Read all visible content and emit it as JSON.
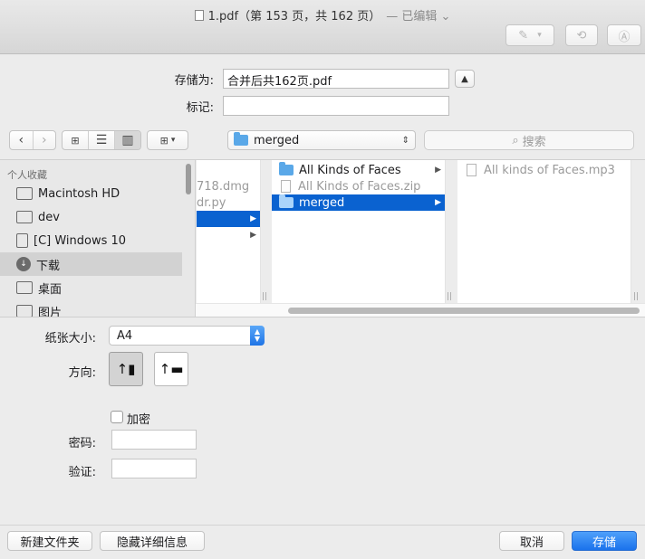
{
  "titlebar": {
    "title": "1.pdf（第 153 页，共 162 页）",
    "edited": "— 已编辑 ⌄"
  },
  "save": {
    "save_as_label": "存储为:",
    "filename": "合并后共162页.pdf",
    "tags_label": "标记:",
    "tags_value": ""
  },
  "toolbar": {
    "location": "merged",
    "search_placeholder": "搜索"
  },
  "sidebar": {
    "heading": "个人收藏",
    "items": [
      {
        "label": "Macintosh HD",
        "icon": "hard-drive-icon"
      },
      {
        "label": "dev",
        "icon": "folder-icon"
      },
      {
        "label": "[C] Windows 10",
        "icon": "document-icon"
      },
      {
        "label": "下载",
        "icon": "download-icon"
      },
      {
        "label": "桌面",
        "icon": "desktop-icon"
      },
      {
        "label": "图片",
        "icon": "camera-icon"
      }
    ]
  },
  "columns": {
    "col1": [
      "718.dmg",
      "dr.py"
    ],
    "col2": [
      {
        "label": "All Kinds of Faces",
        "type": "folder"
      },
      {
        "label": "All Kinds of Faces.zip",
        "type": "file"
      },
      {
        "label": "merged",
        "type": "folder"
      }
    ],
    "col3": [
      "All kinds of Faces.mp3"
    ]
  },
  "options": {
    "paper_label": "纸张大小:",
    "paper_value": "A4",
    "orientation_label": "方向:",
    "encrypt_label": "加密",
    "password_label": "密码:",
    "verify_label": "验证:"
  },
  "buttons": {
    "new_folder": "新建文件夹",
    "hide_details": "隐藏详细信息",
    "cancel": "取消",
    "save": "存储"
  },
  "colors": {
    "accent": "#1a72ec",
    "selection": "#0a62d0"
  }
}
